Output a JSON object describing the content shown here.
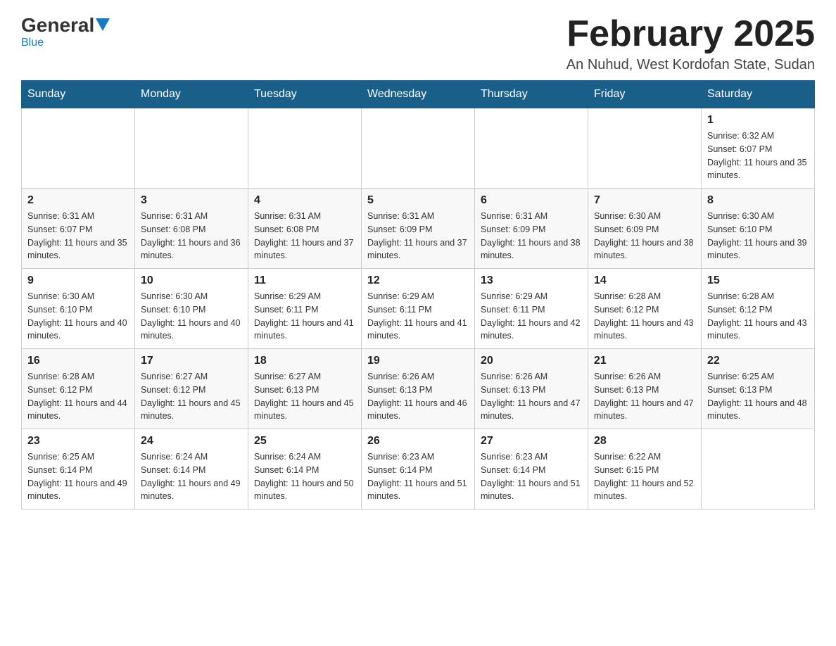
{
  "header": {
    "logo_general": "General",
    "logo_blue": "Blue",
    "title": "February 2025",
    "subtitle": "An Nuhud, West Kordofan State, Sudan"
  },
  "weekdays": [
    "Sunday",
    "Monday",
    "Tuesday",
    "Wednesday",
    "Thursday",
    "Friday",
    "Saturday"
  ],
  "weeks": [
    [
      {
        "day": "",
        "sunrise": "",
        "sunset": "",
        "daylight": ""
      },
      {
        "day": "",
        "sunrise": "",
        "sunset": "",
        "daylight": ""
      },
      {
        "day": "",
        "sunrise": "",
        "sunset": "",
        "daylight": ""
      },
      {
        "day": "",
        "sunrise": "",
        "sunset": "",
        "daylight": ""
      },
      {
        "day": "",
        "sunrise": "",
        "sunset": "",
        "daylight": ""
      },
      {
        "day": "",
        "sunrise": "",
        "sunset": "",
        "daylight": ""
      },
      {
        "day": "1",
        "sunrise": "Sunrise: 6:32 AM",
        "sunset": "Sunset: 6:07 PM",
        "daylight": "Daylight: 11 hours and 35 minutes."
      }
    ],
    [
      {
        "day": "2",
        "sunrise": "Sunrise: 6:31 AM",
        "sunset": "Sunset: 6:07 PM",
        "daylight": "Daylight: 11 hours and 35 minutes."
      },
      {
        "day": "3",
        "sunrise": "Sunrise: 6:31 AM",
        "sunset": "Sunset: 6:08 PM",
        "daylight": "Daylight: 11 hours and 36 minutes."
      },
      {
        "day": "4",
        "sunrise": "Sunrise: 6:31 AM",
        "sunset": "Sunset: 6:08 PM",
        "daylight": "Daylight: 11 hours and 37 minutes."
      },
      {
        "day": "5",
        "sunrise": "Sunrise: 6:31 AM",
        "sunset": "Sunset: 6:09 PM",
        "daylight": "Daylight: 11 hours and 37 minutes."
      },
      {
        "day": "6",
        "sunrise": "Sunrise: 6:31 AM",
        "sunset": "Sunset: 6:09 PM",
        "daylight": "Daylight: 11 hours and 38 minutes."
      },
      {
        "day": "7",
        "sunrise": "Sunrise: 6:30 AM",
        "sunset": "Sunset: 6:09 PM",
        "daylight": "Daylight: 11 hours and 38 minutes."
      },
      {
        "day": "8",
        "sunrise": "Sunrise: 6:30 AM",
        "sunset": "Sunset: 6:10 PM",
        "daylight": "Daylight: 11 hours and 39 minutes."
      }
    ],
    [
      {
        "day": "9",
        "sunrise": "Sunrise: 6:30 AM",
        "sunset": "Sunset: 6:10 PM",
        "daylight": "Daylight: 11 hours and 40 minutes."
      },
      {
        "day": "10",
        "sunrise": "Sunrise: 6:30 AM",
        "sunset": "Sunset: 6:10 PM",
        "daylight": "Daylight: 11 hours and 40 minutes."
      },
      {
        "day": "11",
        "sunrise": "Sunrise: 6:29 AM",
        "sunset": "Sunset: 6:11 PM",
        "daylight": "Daylight: 11 hours and 41 minutes."
      },
      {
        "day": "12",
        "sunrise": "Sunrise: 6:29 AM",
        "sunset": "Sunset: 6:11 PM",
        "daylight": "Daylight: 11 hours and 41 minutes."
      },
      {
        "day": "13",
        "sunrise": "Sunrise: 6:29 AM",
        "sunset": "Sunset: 6:11 PM",
        "daylight": "Daylight: 11 hours and 42 minutes."
      },
      {
        "day": "14",
        "sunrise": "Sunrise: 6:28 AM",
        "sunset": "Sunset: 6:12 PM",
        "daylight": "Daylight: 11 hours and 43 minutes."
      },
      {
        "day": "15",
        "sunrise": "Sunrise: 6:28 AM",
        "sunset": "Sunset: 6:12 PM",
        "daylight": "Daylight: 11 hours and 43 minutes."
      }
    ],
    [
      {
        "day": "16",
        "sunrise": "Sunrise: 6:28 AM",
        "sunset": "Sunset: 6:12 PM",
        "daylight": "Daylight: 11 hours and 44 minutes."
      },
      {
        "day": "17",
        "sunrise": "Sunrise: 6:27 AM",
        "sunset": "Sunset: 6:12 PM",
        "daylight": "Daylight: 11 hours and 45 minutes."
      },
      {
        "day": "18",
        "sunrise": "Sunrise: 6:27 AM",
        "sunset": "Sunset: 6:13 PM",
        "daylight": "Daylight: 11 hours and 45 minutes."
      },
      {
        "day": "19",
        "sunrise": "Sunrise: 6:26 AM",
        "sunset": "Sunset: 6:13 PM",
        "daylight": "Daylight: 11 hours and 46 minutes."
      },
      {
        "day": "20",
        "sunrise": "Sunrise: 6:26 AM",
        "sunset": "Sunset: 6:13 PM",
        "daylight": "Daylight: 11 hours and 47 minutes."
      },
      {
        "day": "21",
        "sunrise": "Sunrise: 6:26 AM",
        "sunset": "Sunset: 6:13 PM",
        "daylight": "Daylight: 11 hours and 47 minutes."
      },
      {
        "day": "22",
        "sunrise": "Sunrise: 6:25 AM",
        "sunset": "Sunset: 6:13 PM",
        "daylight": "Daylight: 11 hours and 48 minutes."
      }
    ],
    [
      {
        "day": "23",
        "sunrise": "Sunrise: 6:25 AM",
        "sunset": "Sunset: 6:14 PM",
        "daylight": "Daylight: 11 hours and 49 minutes."
      },
      {
        "day": "24",
        "sunrise": "Sunrise: 6:24 AM",
        "sunset": "Sunset: 6:14 PM",
        "daylight": "Daylight: 11 hours and 49 minutes."
      },
      {
        "day": "25",
        "sunrise": "Sunrise: 6:24 AM",
        "sunset": "Sunset: 6:14 PM",
        "daylight": "Daylight: 11 hours and 50 minutes."
      },
      {
        "day": "26",
        "sunrise": "Sunrise: 6:23 AM",
        "sunset": "Sunset: 6:14 PM",
        "daylight": "Daylight: 11 hours and 51 minutes."
      },
      {
        "day": "27",
        "sunrise": "Sunrise: 6:23 AM",
        "sunset": "Sunset: 6:14 PM",
        "daylight": "Daylight: 11 hours and 51 minutes."
      },
      {
        "day": "28",
        "sunrise": "Sunrise: 6:22 AM",
        "sunset": "Sunset: 6:15 PM",
        "daylight": "Daylight: 11 hours and 52 minutes."
      },
      {
        "day": "",
        "sunrise": "",
        "sunset": "",
        "daylight": ""
      }
    ]
  ]
}
